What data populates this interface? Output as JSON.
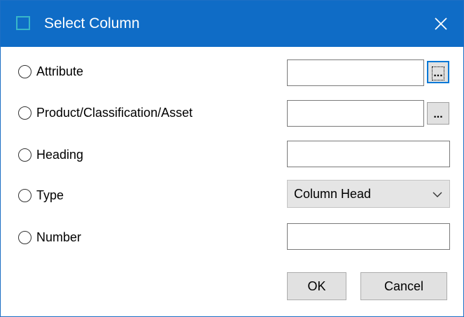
{
  "window": {
    "title": "Select Column",
    "colors": {
      "titlebar": "#0f6cc6",
      "icon_border": "#38b6c9"
    }
  },
  "rows": {
    "attribute": {
      "label": "Attribute",
      "value": "",
      "browse_label": "..."
    },
    "product": {
      "label": "Product/Classification/Asset",
      "value": "",
      "browse_label": "..."
    },
    "heading": {
      "label": "Heading",
      "value": ""
    },
    "type": {
      "label": "Type",
      "selected": "Column Head"
    },
    "number": {
      "label": "Number",
      "value": ""
    }
  },
  "buttons": {
    "ok": "OK",
    "cancel": "Cancel"
  }
}
